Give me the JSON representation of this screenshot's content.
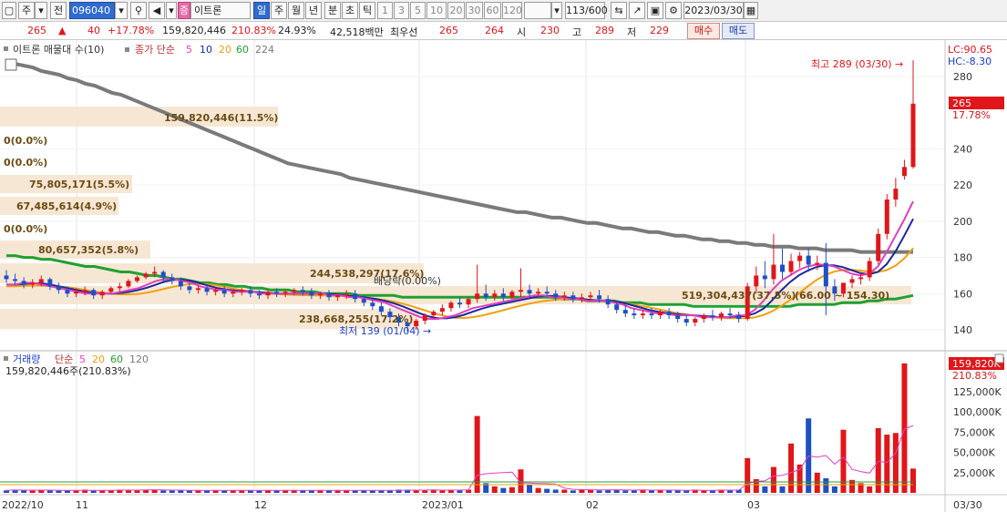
{
  "toolbar": {
    "type_label": "주",
    "type_btn": "전",
    "code": "096040",
    "zeung": "증",
    "name": "이트론",
    "periods": [
      "일",
      "주",
      "월",
      "년",
      "분",
      "초",
      "틱"
    ],
    "minutes": [
      "1",
      "3",
      "5",
      "10",
      "20",
      "30",
      "60",
      "120"
    ],
    "count": "113",
    "count_total": "/600",
    "date": "2023/03/30"
  },
  "quote": {
    "price": "265",
    "arrow": "▲",
    "change": "40",
    "rate": "+17.78%",
    "volume": "159,820,446",
    "vol_ratio": "210.83%",
    "turnover": "24.93%",
    "amount": "42,518백만",
    "best_ask_label": "최우선",
    "best_ask": "265",
    "best_bid": "264",
    "open_label": "시",
    "open": "230",
    "high_label": "고",
    "high": "289",
    "low_label": "저",
    "low": "229",
    "buy": "매수",
    "sell": "매도"
  },
  "colors": {
    "up": "#e0161a",
    "down": "#1f4fc4",
    "ma5": "#e040c0",
    "ma10": "#1a2a9a",
    "ma20": "#f0a010",
    "ma60": "#20a030",
    "ma224": "#7a7a7a",
    "band": "#f5e3cc"
  },
  "price_panel": {
    "legend_name": "이트론 매물대 수(10)",
    "legend_ma": "종가 단순",
    "legend_periods": [
      "5",
      "10",
      "20",
      "60",
      "224"
    ],
    "lc": "LC:90.65",
    "hc": "HC:-8.30",
    "current": "265",
    "current_pct": "17.78%",
    "high_note": "최고 289 (03/30) →",
    "low_note": "최저 139 (01/04) →",
    "dividend": "배당락(0.00%)",
    "bands": [
      "159,820,446(11.5%)",
      "0(0.0%)",
      "0(0.0%)",
      "75,805,171(5.5%)",
      "67,485,614(4.9%)",
      "0(0.0%)",
      "80,657,352(5.8%)",
      "244,538,297(17.6%)",
      "519,304,437(37.5%)",
      "238,668,255(17.2%)"
    ],
    "range_note": "(66.00 ~ 154.30)"
  },
  "volume_panel": {
    "legend_name": "거래량",
    "legend_ma": "단순",
    "legend_periods": [
      "5",
      "20",
      "60",
      "120"
    ],
    "info": "159,820,446주(210.83%)",
    "current": "159,820K",
    "current_pct": "210.83%"
  },
  "chart_data": {
    "type": "candlestick",
    "dates_axis": [
      "2022/10",
      "11",
      "12",
      "2023/01",
      "02",
      "03",
      "03/30"
    ],
    "price_ticks": [
      140,
      160,
      180,
      200,
      220,
      240,
      280
    ],
    "volume_ticks": [
      "25,000K",
      "50,000K",
      "75,000K",
      "100,000K",
      "125,000K"
    ],
    "ylim": [
      130,
      296
    ],
    "vol_ylim": [
      0,
      170000
    ],
    "candles": [
      {
        "o": 170,
        "h": 173,
        "c": 168,
        "l": 166
      },
      {
        "o": 168,
        "h": 171,
        "c": 167,
        "l": 165
      },
      {
        "o": 167,
        "h": 169,
        "c": 165,
        "l": 163
      },
      {
        "o": 165,
        "h": 168,
        "c": 166,
        "l": 163
      },
      {
        "o": 166,
        "h": 170,
        "c": 168,
        "l": 164
      },
      {
        "o": 168,
        "h": 169,
        "c": 164,
        "l": 162
      },
      {
        "o": 164,
        "h": 166,
        "c": 162,
        "l": 160
      },
      {
        "o": 162,
        "h": 164,
        "c": 160,
        "l": 158
      },
      {
        "o": 160,
        "h": 163,
        "c": 161,
        "l": 158
      },
      {
        "o": 161,
        "h": 164,
        "c": 162,
        "l": 159
      },
      {
        "o": 162,
        "h": 163,
        "c": 159,
        "l": 157
      },
      {
        "o": 159,
        "h": 162,
        "c": 161,
        "l": 157
      },
      {
        "o": 161,
        "h": 164,
        "c": 163,
        "l": 160
      },
      {
        "o": 163,
        "h": 166,
        "c": 164,
        "l": 161
      },
      {
        "o": 164,
        "h": 168,
        "c": 167,
        "l": 163
      },
      {
        "o": 167,
        "h": 170,
        "c": 169,
        "l": 166
      },
      {
        "o": 169,
        "h": 172,
        "c": 171,
        "l": 168
      },
      {
        "o": 171,
        "h": 175,
        "c": 172,
        "l": 169
      },
      {
        "o": 172,
        "h": 173,
        "c": 169,
        "l": 167
      },
      {
        "o": 169,
        "h": 171,
        "c": 167,
        "l": 165
      },
      {
        "o": 167,
        "h": 169,
        "c": 164,
        "l": 162
      },
      {
        "o": 164,
        "h": 166,
        "c": 162,
        "l": 160
      },
      {
        "o": 162,
        "h": 164,
        "c": 163,
        "l": 160
      },
      {
        "o": 163,
        "h": 165,
        "c": 161,
        "l": 159
      },
      {
        "o": 161,
        "h": 163,
        "c": 162,
        "l": 159
      },
      {
        "o": 162,
        "h": 164,
        "c": 160,
        "l": 158
      },
      {
        "o": 160,
        "h": 162,
        "c": 161,
        "l": 158
      },
      {
        "o": 161,
        "h": 163,
        "c": 162,
        "l": 159
      },
      {
        "o": 162,
        "h": 164,
        "c": 160,
        "l": 158
      },
      {
        "o": 160,
        "h": 162,
        "c": 159,
        "l": 157
      },
      {
        "o": 159,
        "h": 162,
        "c": 161,
        "l": 157
      },
      {
        "o": 161,
        "h": 163,
        "c": 160,
        "l": 158
      },
      {
        "o": 160,
        "h": 162,
        "c": 161,
        "l": 158
      },
      {
        "o": 161,
        "h": 163,
        "c": 162,
        "l": 159
      },
      {
        "o": 162,
        "h": 164,
        "c": 161,
        "l": 159
      },
      {
        "o": 161,
        "h": 163,
        "c": 159,
        "l": 157
      },
      {
        "o": 159,
        "h": 161,
        "c": 160,
        "l": 157
      },
      {
        "o": 160,
        "h": 162,
        "c": 158,
        "l": 156
      },
      {
        "o": 158,
        "h": 160,
        "c": 159,
        "l": 156
      },
      {
        "o": 159,
        "h": 162,
        "c": 160,
        "l": 157
      },
      {
        "o": 160,
        "h": 162,
        "c": 157,
        "l": 155
      },
      {
        "o": 157,
        "h": 159,
        "c": 155,
        "l": 153
      },
      {
        "o": 155,
        "h": 157,
        "c": 153,
        "l": 151
      },
      {
        "o": 153,
        "h": 155,
        "c": 150,
        "l": 148
      },
      {
        "o": 150,
        "h": 152,
        "c": 147,
        "l": 145
      },
      {
        "o": 147,
        "h": 149,
        "c": 144,
        "l": 142
      },
      {
        "o": 144,
        "h": 146,
        "c": 142,
        "l": 139
      },
      {
        "o": 142,
        "h": 146,
        "c": 145,
        "l": 140
      },
      {
        "o": 145,
        "h": 149,
        "c": 148,
        "l": 143
      },
      {
        "o": 148,
        "h": 151,
        "c": 150,
        "l": 146
      },
      {
        "o": 150,
        "h": 154,
        "c": 152,
        "l": 148
      },
      {
        "o": 152,
        "h": 156,
        "c": 155,
        "l": 150
      },
      {
        "o": 155,
        "h": 158,
        "c": 154,
        "l": 152
      },
      {
        "o": 154,
        "h": 158,
        "c": 157,
        "l": 152
      },
      {
        "o": 157,
        "h": 176,
        "c": 160,
        "l": 155
      },
      {
        "o": 160,
        "h": 165,
        "c": 158,
        "l": 156
      },
      {
        "o": 158,
        "h": 162,
        "c": 160,
        "l": 156
      },
      {
        "o": 160,
        "h": 163,
        "c": 158,
        "l": 156
      },
      {
        "o": 158,
        "h": 162,
        "c": 161,
        "l": 157
      },
      {
        "o": 161,
        "h": 174,
        "c": 162,
        "l": 158
      },
      {
        "o": 162,
        "h": 165,
        "c": 160,
        "l": 158
      },
      {
        "o": 160,
        "h": 163,
        "c": 161,
        "l": 158
      },
      {
        "o": 161,
        "h": 164,
        "c": 160,
        "l": 158
      },
      {
        "o": 160,
        "h": 162,
        "c": 158,
        "l": 156
      },
      {
        "o": 158,
        "h": 161,
        "c": 159,
        "l": 156
      },
      {
        "o": 159,
        "h": 161,
        "c": 157,
        "l": 155
      },
      {
        "o": 157,
        "h": 160,
        "c": 158,
        "l": 155
      },
      {
        "o": 158,
        "h": 161,
        "c": 159,
        "l": 156
      },
      {
        "o": 159,
        "h": 162,
        "c": 157,
        "l": 155
      },
      {
        "o": 157,
        "h": 159,
        "c": 154,
        "l": 152
      },
      {
        "o": 154,
        "h": 156,
        "c": 151,
        "l": 149
      },
      {
        "o": 151,
        "h": 154,
        "c": 149,
        "l": 147
      },
      {
        "o": 149,
        "h": 152,
        "c": 148,
        "l": 146
      },
      {
        "o": 148,
        "h": 151,
        "c": 149,
        "l": 146
      },
      {
        "o": 149,
        "h": 152,
        "c": 148,
        "l": 146
      },
      {
        "o": 148,
        "h": 151,
        "c": 150,
        "l": 146
      },
      {
        "o": 150,
        "h": 152,
        "c": 148,
        "l": 146
      },
      {
        "o": 148,
        "h": 150,
        "c": 146,
        "l": 144
      },
      {
        "o": 146,
        "h": 148,
        "c": 144,
        "l": 142
      },
      {
        "o": 144,
        "h": 147,
        "c": 146,
        "l": 142
      },
      {
        "o": 146,
        "h": 149,
        "c": 148,
        "l": 144
      },
      {
        "o": 148,
        "h": 151,
        "c": 147,
        "l": 145
      },
      {
        "o": 147,
        "h": 150,
        "c": 149,
        "l": 145
      },
      {
        "o": 149,
        "h": 152,
        "c": 148,
        "l": 146
      },
      {
        "o": 148,
        "h": 150,
        "c": 146,
        "l": 144
      },
      {
        "o": 146,
        "h": 166,
        "c": 164,
        "l": 145
      },
      {
        "o": 164,
        "h": 175,
        "c": 170,
        "l": 160
      },
      {
        "o": 170,
        "h": 178,
        "c": 168,
        "l": 163
      },
      {
        "o": 168,
        "h": 193,
        "c": 176,
        "l": 165
      },
      {
        "o": 176,
        "h": 185,
        "c": 172,
        "l": 168
      },
      {
        "o": 172,
        "h": 182,
        "c": 178,
        "l": 170
      },
      {
        "o": 178,
        "h": 183,
        "c": 181,
        "l": 174
      },
      {
        "o": 181,
        "h": 185,
        "c": 176,
        "l": 172
      },
      {
        "o": 176,
        "h": 181,
        "c": 177,
        "l": 173
      },
      {
        "o": 177,
        "h": 188,
        "c": 164,
        "l": 148
      },
      {
        "o": 164,
        "h": 168,
        "c": 160,
        "l": 156
      },
      {
        "o": 160,
        "h": 165,
        "c": 166,
        "l": 158
      },
      {
        "o": 166,
        "h": 170,
        "c": 168,
        "l": 163
      },
      {
        "o": 168,
        "h": 172,
        "c": 169,
        "l": 165
      },
      {
        "o": 169,
        "h": 180,
        "c": 178,
        "l": 167
      },
      {
        "o": 178,
        "h": 196,
        "c": 193,
        "l": 176
      },
      {
        "o": 193,
        "h": 215,
        "c": 212,
        "l": 190
      },
      {
        "o": 212,
        "h": 224,
        "c": 218,
        "l": 208
      },
      {
        "o": 225,
        "h": 234,
        "c": 230,
        "l": 223
      },
      {
        "o": 230,
        "h": 289,
        "c": 265,
        "l": 229
      }
    ],
    "volume": [
      3,
      4,
      3,
      3,
      4,
      3,
      3,
      3,
      3,
      4,
      3,
      3,
      3,
      4,
      4,
      3,
      4,
      4,
      3,
      3,
      3,
      3,
      3,
      3,
      3,
      3,
      3,
      3,
      3,
      3,
      3,
      3,
      3,
      3,
      3,
      3,
      3,
      3,
      3,
      3,
      3,
      3,
      3,
      3,
      3,
      4,
      4,
      3,
      3,
      4,
      3,
      4,
      3,
      4,
      95,
      12,
      8,
      6,
      7,
      29,
      10,
      6,
      5,
      4,
      4,
      3,
      4,
      4,
      3,
      4,
      4,
      3,
      3,
      4,
      3,
      4,
      3,
      3,
      3,
      4,
      3,
      3,
      4,
      3,
      4,
      43,
      17,
      8,
      32,
      8,
      61,
      35,
      92,
      25,
      18,
      8,
      78,
      16,
      12,
      8,
      80,
      72,
      74,
      160,
      30,
      22,
      18,
      14,
      12,
      10,
      8,
      7,
      6,
      5,
      4
    ],
    "ma5": [
      165,
      165,
      166,
      166,
      165,
      164,
      163,
      162,
      161,
      160,
      160,
      160,
      160,
      161,
      162,
      163,
      165,
      167,
      168,
      168,
      167,
      166,
      164,
      163,
      162,
      162,
      161,
      161,
      161,
      160,
      160,
      160,
      160,
      160,
      160,
      160,
      160,
      159,
      159,
      158,
      158,
      157,
      156,
      155,
      153,
      151,
      149,
      147,
      146,
      146,
      147,
      148,
      150,
      152,
      153,
      154,
      155,
      156,
      157,
      158,
      159,
      159,
      158,
      158,
      157,
      157,
      156,
      156,
      156,
      155,
      154,
      152,
      151,
      150,
      149,
      149,
      148,
      148,
      148,
      147,
      147,
      147,
      147,
      148,
      148,
      151,
      156,
      162,
      167,
      170,
      173,
      175,
      176,
      176,
      175,
      173,
      171,
      170,
      171,
      175,
      183,
      192,
      201,
      211
    ],
    "ma224": [
      288,
      287,
      286,
      285,
      283,
      282,
      281,
      279,
      278,
      276,
      275,
      273,
      271,
      270,
      268,
      266,
      264,
      262,
      260,
      258,
      256,
      254,
      252,
      250,
      248,
      246,
      244,
      242,
      240,
      238,
      236,
      234,
      232,
      231,
      230,
      229,
      228,
      227,
      226,
      224,
      223,
      222,
      221,
      220,
      219,
      218,
      217,
      216,
      215,
      214,
      213,
      212,
      211,
      210,
      209,
      208,
      207,
      206,
      205,
      205,
      204,
      203,
      202,
      202,
      201,
      200,
      199,
      199,
      198,
      197,
      196,
      196,
      195,
      194,
      194,
      193,
      192,
      192,
      191,
      190,
      190,
      189,
      189,
      188,
      188,
      187,
      187,
      186,
      186,
      186,
      185,
      185,
      185,
      184,
      184,
      184,
      184,
      183,
      183,
      183,
      183,
      183,
      183,
      183
    ],
    "ma60": [
      181,
      181,
      180,
      180,
      179,
      179,
      178,
      177,
      176,
      175,
      175,
      174,
      173,
      172,
      172,
      171,
      170,
      170,
      169,
      168,
      168,
      167,
      166,
      166,
      165,
      165,
      164,
      164,
      163,
      163,
      162,
      162,
      162,
      161,
      161,
      161,
      160,
      160,
      160,
      160,
      159,
      159,
      159,
      159,
      159,
      158,
      158,
      158,
      158,
      158,
      158,
      158,
      158,
      158,
      158,
      158,
      158,
      158,
      158,
      158,
      158,
      158,
      158,
      157,
      157,
      157,
      156,
      156,
      156,
      156,
      155,
      155,
      155,
      154,
      154,
      154,
      154,
      154,
      153,
      153,
      153,
      153,
      153,
      153,
      153,
      153,
      153,
      153,
      153,
      153,
      154,
      154,
      154,
      154,
      154,
      155,
      155,
      155,
      156,
      156,
      157,
      157,
      158,
      159
    ]
  }
}
